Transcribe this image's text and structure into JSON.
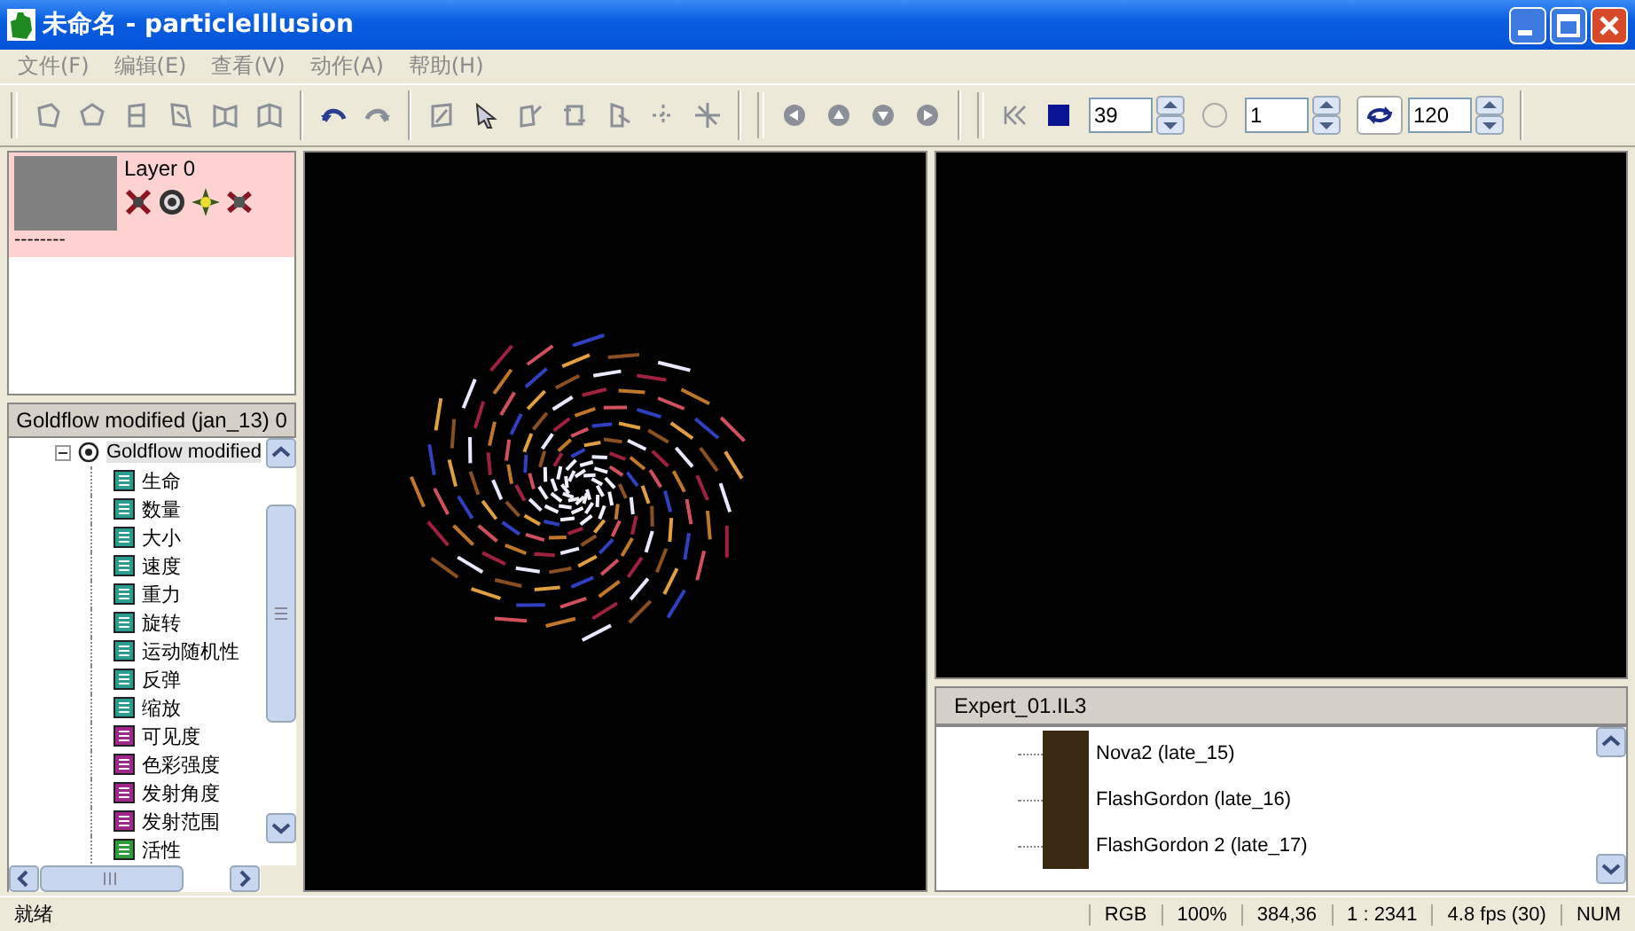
{
  "window": {
    "title": "未命名 - particleIllusion"
  },
  "menu": [
    "文件(F)",
    "编辑(E)",
    "查看(V)",
    "动作(A)",
    "帮助(H)"
  ],
  "toolbar": {
    "spin_fields": [
      {
        "value": "39"
      },
      {
        "value": "1"
      },
      {
        "value": "120"
      }
    ]
  },
  "layers": [
    {
      "name": "Layer 0",
      "note": "--------",
      "selected": true
    }
  ],
  "emitter_panel": {
    "title": "Goldflow modified (jan_13) 0",
    "tree": {
      "label": "Goldflow modified",
      "expanded": true,
      "children": [
        {
          "label": "生命",
          "color": "#2a9d8f"
        },
        {
          "label": "数量",
          "color": "#2a9d8f"
        },
        {
          "label": "大小",
          "color": "#2a9d8f"
        },
        {
          "label": "速度",
          "color": "#2a9d8f"
        },
        {
          "label": "重力",
          "color": "#2a9d8f"
        },
        {
          "label": "旋转",
          "color": "#2a9d8f"
        },
        {
          "label": "运动随机性",
          "color": "#2a9d8f"
        },
        {
          "label": "反弹",
          "color": "#2a9d8f"
        },
        {
          "label": "缩放",
          "color": "#2a9d8f"
        },
        {
          "label": "可见度",
          "color": "#a0288c"
        },
        {
          "label": "色彩强度",
          "color": "#a0288c"
        },
        {
          "label": "发射角度",
          "color": "#a0288c"
        },
        {
          "label": "发射范围",
          "color": "#a0288c"
        },
        {
          "label": "活性",
          "color": "#2e9a3a"
        }
      ]
    }
  },
  "library": {
    "title": "Expert_01.IL3",
    "items": [
      {
        "label": "Nova2 (late_15)"
      },
      {
        "label": "FlashGordon (late_16)"
      },
      {
        "label": "FlashGordon 2 (late_17)"
      }
    ]
  },
  "status_bar": [
    "就绪",
    "RGB",
    "100%",
    "384,36",
    "1 : 2341",
    "4.8 fps (30)",
    "NUM"
  ]
}
